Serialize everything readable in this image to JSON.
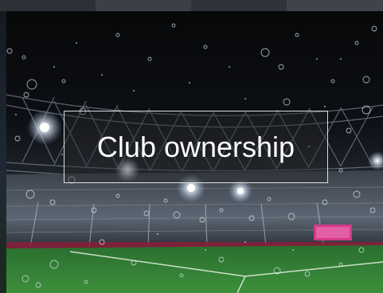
{
  "tile": {
    "caption": "Club ownership",
    "image_icon": "stadium-photo"
  },
  "colors": {
    "sky": "#07080a",
    "pitch": "#2f7d32",
    "caption_text": "#ffffff",
    "caption_border": "#ffffff",
    "screen": "#d43a8a"
  }
}
